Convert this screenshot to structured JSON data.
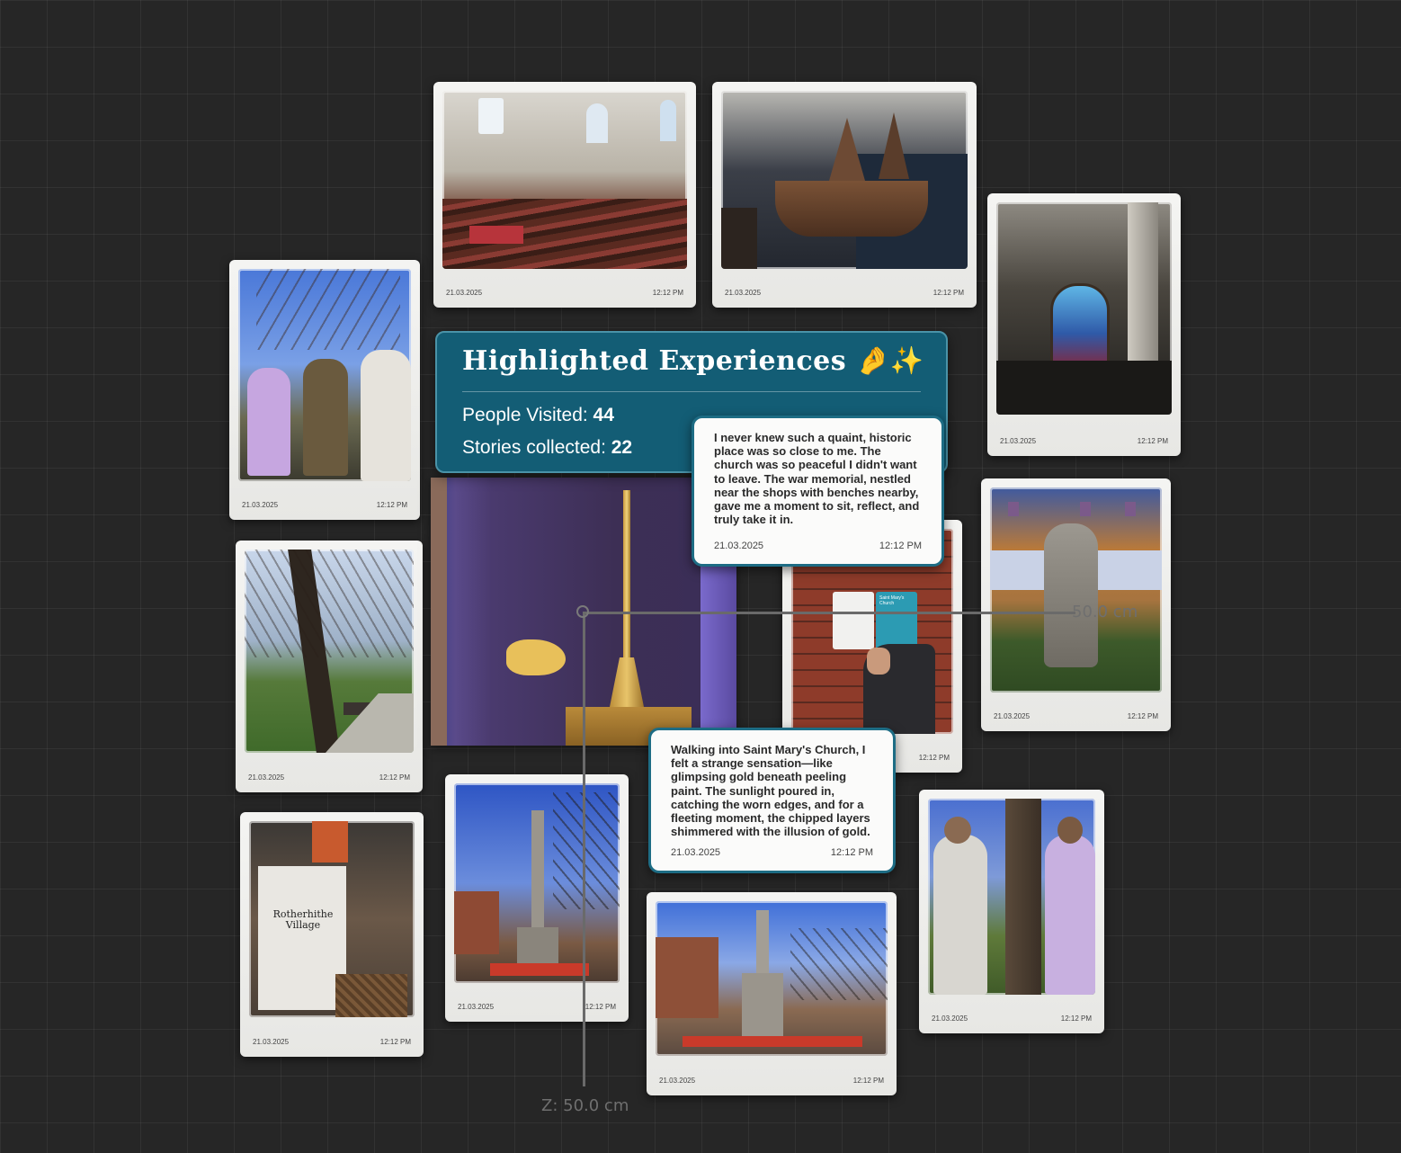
{
  "panel": {
    "title": "Highlighted Experiences 🤌✨",
    "people_label": "People Visited: ",
    "people_value": "44",
    "stories_label": "Stories collected: ",
    "stories_value": "22"
  },
  "notes": [
    {
      "text": "I never knew such a quaint, historic place was so close to me. The church was so peaceful I didn't want to leave. The war memorial, nestled near the shops with benches nearby, gave me a moment to sit, reflect, and truly take it in.",
      "date": "21.03.2025",
      "time": "12:12 PM"
    },
    {
      "text": "Walking into Saint Mary's Church, I felt a strange sensation—like glimpsing gold beneath peeling paint. The sunlight poured in, catching the worn edges, and for a fleeting moment, the chipped layers shimmered with the illusion of gold.",
      "date": "21.03.2025",
      "time": "12:12 PM"
    }
  ],
  "cards": {
    "church_interior": {
      "date": "21.03.2025",
      "time": "12:12 PM"
    },
    "ship_model": {
      "date": "21.03.2025",
      "time": "12:12 PM"
    },
    "stained_glass": {
      "date": "21.03.2025",
      "time": "12:12 PM"
    },
    "group_reading": {
      "date": "21.03.2025",
      "time": "12:12 PM"
    },
    "park_tree": {
      "date": "21.03.2025",
      "time": "12:12 PM"
    },
    "statue_garden": {
      "date": "21.03.2025",
      "time": "12:12 PM"
    },
    "brick_wall_card": {
      "time": "12:12 PM"
    },
    "tea_towel": {
      "date": "21.03.2025",
      "time": "12:12 PM"
    },
    "memorial_column": {
      "date": "21.03.2025",
      "time": "12:12 PM"
    },
    "memorial_street": {
      "date": "21.03.2025",
      "time": "12:12 PM"
    },
    "two_people": {
      "date": "21.03.2025",
      "time": "12:12 PM"
    }
  },
  "photo_text": {
    "tea_towel": "Rotherhithe Village",
    "info_card": "Saint Mary's Church"
  },
  "guides": {
    "x_readout": "50.0 cm",
    "z_readout": "Z:  50.0 cm"
  },
  "colors": {
    "panel_bg": "#135d75",
    "note_border": "#1d6c84",
    "canvas_bg": "#262626"
  }
}
